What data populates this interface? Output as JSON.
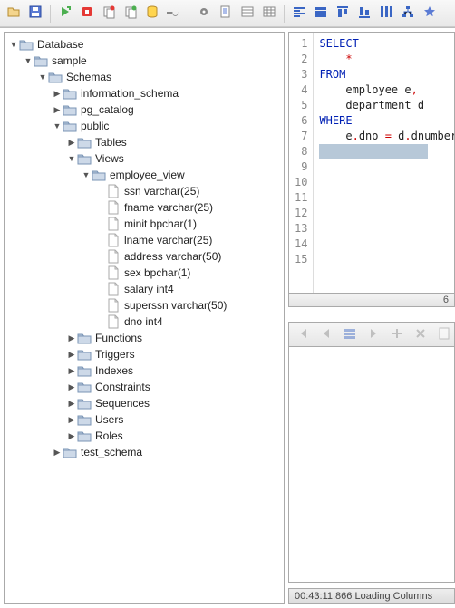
{
  "toolbar": {
    "icons": [
      "open",
      "save",
      "sep",
      "run-green",
      "stop-red",
      "clone",
      "copy",
      "cylinder",
      "wrench",
      "sep",
      "cog",
      "page-copy",
      "page-rows",
      "page-grid",
      "sep",
      "align-left",
      "rows",
      "align-top",
      "align-bottom",
      "columns",
      "hierarchy",
      "star"
    ]
  },
  "tree": [
    {
      "level": 0,
      "type": "folder",
      "arrow": "down",
      "label": "Database"
    },
    {
      "level": 1,
      "type": "folder",
      "arrow": "down",
      "label": "sample"
    },
    {
      "level": 2,
      "type": "folder",
      "arrow": "down",
      "label": "Schemas"
    },
    {
      "level": 3,
      "type": "folder",
      "arrow": "right",
      "label": "information_schema"
    },
    {
      "level": 3,
      "type": "folder",
      "arrow": "right",
      "label": "pg_catalog"
    },
    {
      "level": 3,
      "type": "folder",
      "arrow": "down",
      "label": "public"
    },
    {
      "level": 4,
      "type": "folder",
      "arrow": "right",
      "label": "Tables"
    },
    {
      "level": 4,
      "type": "folder",
      "arrow": "down",
      "label": "Views"
    },
    {
      "level": 5,
      "type": "folder",
      "arrow": "down",
      "label": "employee_view"
    },
    {
      "level": 6,
      "type": "file",
      "arrow": "",
      "label": "ssn varchar(25)"
    },
    {
      "level": 6,
      "type": "file",
      "arrow": "",
      "label": "fname varchar(25)"
    },
    {
      "level": 6,
      "type": "file",
      "arrow": "",
      "label": "minit bpchar(1)"
    },
    {
      "level": 6,
      "type": "file",
      "arrow": "",
      "label": "lname varchar(25)"
    },
    {
      "level": 6,
      "type": "file",
      "arrow": "",
      "label": "address varchar(50)"
    },
    {
      "level": 6,
      "type": "file",
      "arrow": "",
      "label": "sex bpchar(1)"
    },
    {
      "level": 6,
      "type": "file",
      "arrow": "",
      "label": "salary int4"
    },
    {
      "level": 6,
      "type": "file",
      "arrow": "",
      "label": "superssn varchar(50)"
    },
    {
      "level": 6,
      "type": "file",
      "arrow": "",
      "label": "dno int4"
    },
    {
      "level": 4,
      "type": "folder",
      "arrow": "right",
      "label": "Functions"
    },
    {
      "level": 4,
      "type": "folder",
      "arrow": "right",
      "label": "Triggers"
    },
    {
      "level": 4,
      "type": "folder",
      "arrow": "right",
      "label": "Indexes"
    },
    {
      "level": 4,
      "type": "folder",
      "arrow": "right",
      "label": "Constraints"
    },
    {
      "level": 4,
      "type": "folder",
      "arrow": "right",
      "label": "Sequences"
    },
    {
      "level": 4,
      "type": "folder",
      "arrow": "right",
      "label": "Users"
    },
    {
      "level": 4,
      "type": "folder",
      "arrow": "right",
      "label": "Roles"
    },
    {
      "level": 3,
      "type": "folder",
      "arrow": "right",
      "label": "test_schema"
    }
  ],
  "sql": {
    "lines": [
      {
        "n": 1,
        "tokens": [
          {
            "t": "SELECT",
            "c": "kw"
          }
        ]
      },
      {
        "n": 2,
        "tokens": [
          {
            "t": "    ",
            "c": ""
          },
          {
            "t": "*",
            "c": "op"
          }
        ]
      },
      {
        "n": 3,
        "tokens": [
          {
            "t": "FROM",
            "c": "kw"
          }
        ]
      },
      {
        "n": 4,
        "tokens": [
          {
            "t": "    employee e",
            "c": ""
          },
          {
            "t": ",",
            "c": "op"
          }
        ]
      },
      {
        "n": 5,
        "tokens": [
          {
            "t": "    department d",
            "c": ""
          }
        ]
      },
      {
        "n": 6,
        "tokens": [
          {
            "t": "WHERE",
            "c": "kw"
          }
        ]
      },
      {
        "n": 7,
        "tokens": [
          {
            "t": "    e",
            "c": ""
          },
          {
            "t": ".",
            "c": "op"
          },
          {
            "t": "dno ",
            "c": ""
          },
          {
            "t": "=",
            "c": "op"
          },
          {
            "t": " d",
            "c": ""
          },
          {
            "t": ".",
            "c": "op"
          },
          {
            "t": "dnumber",
            "c": ""
          }
        ]
      },
      {
        "n": 8,
        "tokens": [],
        "current": true
      },
      {
        "n": 9,
        "tokens": []
      },
      {
        "n": 10,
        "tokens": []
      },
      {
        "n": 11,
        "tokens": []
      },
      {
        "n": 12,
        "tokens": []
      },
      {
        "n": 13,
        "tokens": []
      },
      {
        "n": 14,
        "tokens": []
      },
      {
        "n": 15,
        "tokens": []
      }
    ]
  },
  "hscroll_label": "6",
  "results_toolbar": [
    "nav-first",
    "nav-prev",
    "rows",
    "nav-next",
    "nav-add",
    "nav-del",
    "page",
    "commit"
  ],
  "status": "00:43:11:866 Loading Columns"
}
